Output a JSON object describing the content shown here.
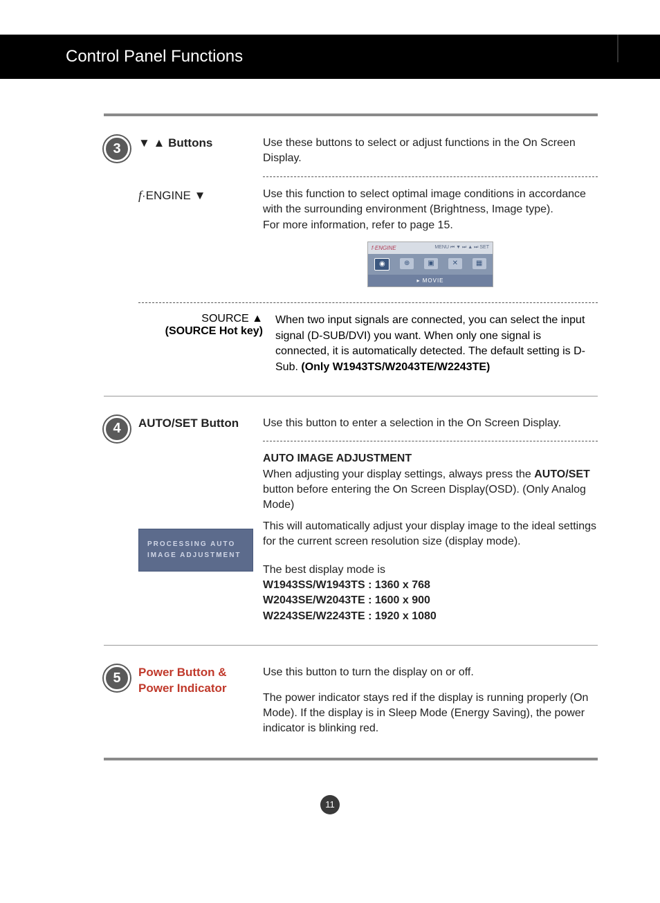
{
  "header": "Control Panel Functions",
  "section3": {
    "num": "3",
    "buttons_label": "▼  ▲  Buttons",
    "buttons_desc": "Use these buttons to select or adjust functions in the On Screen Display.",
    "fengine_label_prefix": "f",
    "fengine_label_text": "·ENGINE ▼",
    "fengine_desc": "Use this function to select optimal image conditions in accordance with the surrounding environment (Brightness, Image type).\nFor more information, refer to page 15.",
    "osd": {
      "brand": "f·ENGINE",
      "controls": "MENU ⏮  ▼ ⏭  ▲ ⏭  SET",
      "footer": "▸  MOVIE"
    },
    "source_line1": "SOURCE ▲",
    "source_line2": "(SOURCE Hot key)",
    "source_desc_a": "When two input signals are connected, you can select the input signal (D-SUB/DVI) you want. When only one signal is connected, it is automatically detected. The default setting is D-Sub. ",
    "source_desc_b": "(Only W1943TS/W2043TE/W2243TE)"
  },
  "section4": {
    "num": "4",
    "label": "AUTO/SET Button",
    "desc1": "Use this button to enter a selection in the On Screen Display.",
    "auto_title": "AUTO IMAGE ADJUSTMENT",
    "auto_p1a": "When adjusting your display settings, always press the ",
    "auto_p1b": "AUTO/SET",
    "auto_p1c": " button before entering the On Screen Display(OSD). (Only Analog Mode)",
    "auto_p2": "This will automatically adjust your display image to the ideal settings for the current screen resolution size (display mode).",
    "best_intro": "The best display mode is",
    "best_1": "W1943SS/W1943TS : 1360 x 768",
    "best_2": "W2043SE/W2043TE : 1600 x 900",
    "best_3": "W2243SE/W2243TE : 1920 x 1080",
    "processing_l1": "PROCESSING AUTO",
    "processing_l2": "IMAGE ADJUSTMENT"
  },
  "section5": {
    "num": "5",
    "label": "Power Button & Power Indicator",
    "desc1": "Use this button to turn the display on or off.",
    "desc2": "The power indicator stays red if the display is running properly (On Mode). If the display is in Sleep Mode (Energy Saving), the power indicator is blinking red."
  },
  "page_number": "11"
}
